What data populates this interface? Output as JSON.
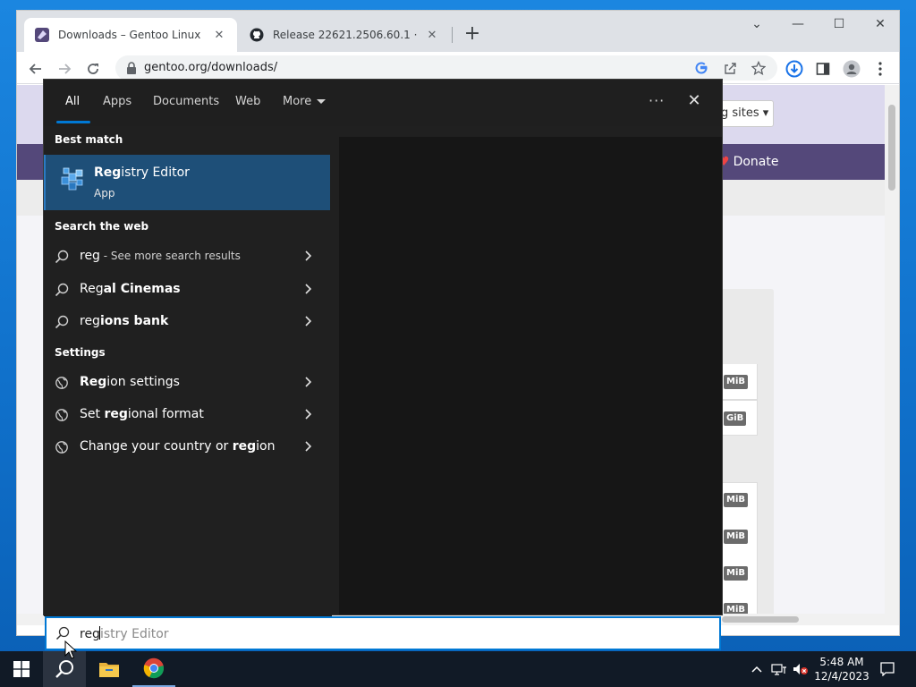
{
  "browser": {
    "tabs": [
      {
        "title": "Downloads – Gentoo Linux",
        "close": "✕"
      },
      {
        "title": "Release 22621.2506.60.1 · valinet/",
        "close": "✕"
      }
    ],
    "new_tab": "+",
    "window_controls": {
      "dropdown": "⌄",
      "minimize": "—",
      "maximize": "☐",
      "close": "✕"
    },
    "url": "gentoo.org/downloads/"
  },
  "page": {
    "mirror_button": "g sites ▾",
    "donate": "Donate",
    "size_badges": [
      "MiB",
      "GiB",
      "MiB",
      "MiB",
      "MiB",
      "MiB"
    ]
  },
  "search_panel": {
    "tabs": [
      "All",
      "Apps",
      "Documents",
      "Web",
      "More"
    ],
    "more_options": "···",
    "close": "✕",
    "best_match_label": "Best match",
    "best_match": {
      "title_bold": "Reg",
      "title_rest": "istry Editor",
      "subtitle": "App"
    },
    "web_label": "Search the web",
    "web_results": [
      {
        "bold": "reg",
        "rest": "",
        "dim": " - See more search results"
      },
      {
        "bold": "Reg",
        "rest": "al Cinemas",
        "dim": ""
      },
      {
        "bold": "reg",
        "rest": "ions bank",
        "dim": ""
      }
    ],
    "settings_label": "Settings",
    "settings_results": [
      {
        "pre": "",
        "bold": "Reg",
        "post": "ion settings"
      },
      {
        "pre": "Set ",
        "bold": "reg",
        "post": "ional format"
      },
      {
        "pre": "Change your country or ",
        "bold": "reg",
        "post": "ion"
      }
    ]
  },
  "search_box": {
    "typed": "reg",
    "suggestion": "istry Editor"
  },
  "taskbar": {
    "time": "5:48 AM",
    "date": "12/4/2023"
  },
  "colors": {
    "accent": "#0078d4",
    "panel_bg": "#202020",
    "best_match_bg": "#1e4f78",
    "gentoo_nav": "#54487a"
  }
}
